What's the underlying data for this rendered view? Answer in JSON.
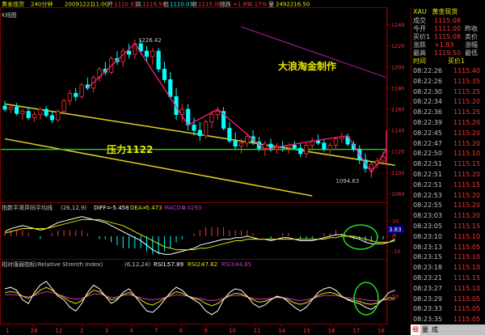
{
  "header": {
    "instrument": "黄金现货",
    "period": "240分钟",
    "date": "20091221",
    "time": "11:00",
    "open_label": "开",
    "open": "1110.93",
    "high_label": "高",
    "high": "1119.50",
    "low_label": "低",
    "low": "1110.03",
    "close_label": "收",
    "close": "1115.08",
    "change_label": "涨跌",
    "change": "+1.89",
    "pct": "0.17%",
    "amount_label": "量",
    "amount": "2492216.50"
  },
  "main_panel": {
    "label": "K线图",
    "price_labels": [
      {
        "value": 1240,
        "text": "1240"
      },
      {
        "value": 1220,
        "text": "1220"
      },
      {
        "value": 1200,
        "text": "1200"
      },
      {
        "value": 1180,
        "text": "1180"
      },
      {
        "value": 1160,
        "text": "1160"
      },
      {
        "value": 1140,
        "text": "1140"
      },
      {
        "value": 1120,
        "text": "1120"
      },
      {
        "value": 1100,
        "text": "1100"
      },
      {
        "value": 1080,
        "text": "1080"
      }
    ],
    "annotations": {
      "high_mark": "1226.42",
      "low_mark": "1094.63",
      "resistance": "压力1122",
      "credit": "大浪淘金制作"
    }
  },
  "macd_panel": {
    "title": "指数平滑异同平均线",
    "params": "(26,12,9)",
    "diff_label": "DIFF=",
    "diff": "-5.458",
    "dea_label": "DEA=",
    "dea": "-5.473",
    "macd_label": "MACD=",
    "macd": "0.0293",
    "axis_labels": [
      "10",
      "0",
      "-10"
    ],
    "value_box": "3.83"
  },
  "rsi_panel": {
    "title": "相对强弱指标(Relative Strenth Index)",
    "params": "(6,12,24)",
    "rsi1_label": "RSI1:",
    "rsi1": "57.89",
    "rsi2_label": "RSI2:",
    "rsi2": "47.82",
    "rsi3_label": "RSI3:",
    "rsi3": "44.85",
    "axis_labels": [
      "50"
    ]
  },
  "x_axis": {
    "labels": [
      "1",
      "28",
      "12",
      "2",
      "3",
      "4",
      "7",
      "8",
      "9",
      "10",
      "11",
      "14",
      "15",
      "16",
      "17",
      "18"
    ]
  },
  "side_panel": {
    "symbol": "XAU",
    "name": "黄金现货",
    "quote_rows": [
      {
        "label": "成交",
        "value": "1115.08",
        "label2": "",
        "value2": ""
      },
      {
        "label": "今开",
        "value": "1111.00",
        "label2": "昨收",
        "value2": ""
      },
      {
        "label": "买价1",
        "value": "1115.08",
        "label2": "卖价",
        "value2": ""
      },
      {
        "label": "涨跌",
        "value": "+1.83",
        "label2": "涨幅",
        "value2": ""
      },
      {
        "label": "最高",
        "value": "1119.50",
        "label2": "最低",
        "value2": ""
      }
    ],
    "trade_header_time": "时间",
    "trade_header_price": "买价1",
    "trades": [
      {
        "time": "08:22:26",
        "price": "1115.40"
      },
      {
        "time": "08:22:26",
        "price": "1115.35"
      },
      {
        "time": "08:22:30",
        "price": "1115.25"
      },
      {
        "time": "08:22:34",
        "price": "1115.20"
      },
      {
        "time": "08:22:36",
        "price": "1115.25"
      },
      {
        "time": "08:22:39",
        "price": "1115.20"
      },
      {
        "time": "08:22:45",
        "price": "1115.20"
      },
      {
        "time": "08:22:47",
        "price": "1115.20"
      },
      {
        "time": "08:22:50",
        "price": "1115.10"
      },
      {
        "time": "08:22:51",
        "price": "1115.15"
      },
      {
        "time": "08:22:51",
        "price": "1115.20"
      },
      {
        "time": "08:22:51",
        "price": "1115.15"
      },
      {
        "time": "08:22:53",
        "price": "1115.20"
      },
      {
        "time": "08:22:55",
        "price": "1115.20"
      },
      {
        "time": "08:23:03",
        "price": "1115.20"
      },
      {
        "time": "08:23:05",
        "price": "1115.15"
      },
      {
        "time": "08:23:10",
        "price": "1115.10"
      },
      {
        "time": "08:23:13",
        "price": "1115.05"
      },
      {
        "time": "08:23:15",
        "price": "1115.10"
      },
      {
        "time": "08:23:18",
        "price": "1115.10"
      },
      {
        "time": "08:23:21",
        "price": "1115.15"
      },
      {
        "time": "08:23:27",
        "price": "1115.10"
      },
      {
        "time": "08:23:29",
        "price": "1115.05"
      },
      {
        "time": "08:23:33",
        "price": "1115.05"
      },
      {
        "time": "08:23:35",
        "price": "1115.05"
      }
    ],
    "tabs": [
      "细",
      "量",
      "成"
    ]
  },
  "colors": {
    "up": "#ff3333",
    "down": "#00ffff",
    "channel": "#e6d21e",
    "support": "#22c422",
    "wave": "#ff1e78",
    "upper_line": "#b01ea0",
    "diff_line": "#ffffff",
    "dea_line": "#e6e600",
    "rsi1": "#ffffff",
    "rsi2": "#e6e600",
    "rsi3": "#cc33cc",
    "circle": "#22dd22",
    "header_text": "#e6e600"
  },
  "chart_data": [
    {
      "type": "candlestick",
      "title": "K线图",
      "ylim": [
        1075,
        1245
      ],
      "candles": [
        {
          "o": 1163,
          "h": 1168,
          "l": 1158,
          "c": 1160
        },
        {
          "o": 1160,
          "h": 1165,
          "l": 1156,
          "c": 1162
        },
        {
          "o": 1162,
          "h": 1166,
          "l": 1154,
          "c": 1156
        },
        {
          "o": 1156,
          "h": 1160,
          "l": 1150,
          "c": 1158
        },
        {
          "o": 1158,
          "h": 1162,
          "l": 1150,
          "c": 1152
        },
        {
          "o": 1152,
          "h": 1158,
          "l": 1148,
          "c": 1155
        },
        {
          "o": 1155,
          "h": 1162,
          "l": 1150,
          "c": 1160
        },
        {
          "o": 1160,
          "h": 1163,
          "l": 1152,
          "c": 1154
        },
        {
          "o": 1154,
          "h": 1158,
          "l": 1147,
          "c": 1150
        },
        {
          "o": 1150,
          "h": 1160,
          "l": 1148,
          "c": 1158
        },
        {
          "o": 1158,
          "h": 1170,
          "l": 1155,
          "c": 1168
        },
        {
          "o": 1168,
          "h": 1178,
          "l": 1164,
          "c": 1175
        },
        {
          "o": 1175,
          "h": 1180,
          "l": 1168,
          "c": 1172
        },
        {
          "o": 1172,
          "h": 1185,
          "l": 1170,
          "c": 1183
        },
        {
          "o": 1183,
          "h": 1190,
          "l": 1178,
          "c": 1180
        },
        {
          "o": 1180,
          "h": 1192,
          "l": 1176,
          "c": 1190
        },
        {
          "o": 1190,
          "h": 1200,
          "l": 1186,
          "c": 1198
        },
        {
          "o": 1198,
          "h": 1205,
          "l": 1192,
          "c": 1195
        },
        {
          "o": 1195,
          "h": 1210,
          "l": 1193,
          "c": 1208
        },
        {
          "o": 1208,
          "h": 1215,
          "l": 1202,
          "c": 1205
        },
        {
          "o": 1205,
          "h": 1218,
          "l": 1200,
          "c": 1215
        },
        {
          "o": 1215,
          "h": 1222,
          "l": 1208,
          "c": 1212
        },
        {
          "o": 1212,
          "h": 1226,
          "l": 1208,
          "c": 1222
        },
        {
          "o": 1222,
          "h": 1226,
          "l": 1212,
          "c": 1215
        },
        {
          "o": 1215,
          "h": 1220,
          "l": 1205,
          "c": 1210
        },
        {
          "o": 1210,
          "h": 1218,
          "l": 1202,
          "c": 1215
        },
        {
          "o": 1215,
          "h": 1218,
          "l": 1195,
          "c": 1198
        },
        {
          "o": 1198,
          "h": 1205,
          "l": 1185,
          "c": 1188
        },
        {
          "o": 1188,
          "h": 1195,
          "l": 1170,
          "c": 1172
        },
        {
          "o": 1172,
          "h": 1180,
          "l": 1150,
          "c": 1155
        },
        {
          "o": 1155,
          "h": 1165,
          "l": 1148,
          "c": 1160
        },
        {
          "o": 1160,
          "h": 1165,
          "l": 1140,
          "c": 1145
        },
        {
          "o": 1145,
          "h": 1152,
          "l": 1135,
          "c": 1140
        },
        {
          "o": 1140,
          "h": 1148,
          "l": 1130,
          "c": 1135
        },
        {
          "o": 1135,
          "h": 1150,
          "l": 1132,
          "c": 1148
        },
        {
          "o": 1148,
          "h": 1158,
          "l": 1142,
          "c": 1155
        },
        {
          "o": 1155,
          "h": 1162,
          "l": 1150,
          "c": 1158
        },
        {
          "o": 1158,
          "h": 1162,
          "l": 1140,
          "c": 1142
        },
        {
          "o": 1142,
          "h": 1148,
          "l": 1128,
          "c": 1130
        },
        {
          "o": 1130,
          "h": 1138,
          "l": 1122,
          "c": 1125
        },
        {
          "o": 1125,
          "h": 1132,
          "l": 1118,
          "c": 1128
        },
        {
          "o": 1128,
          "h": 1136,
          "l": 1124,
          "c": 1134
        },
        {
          "o": 1134,
          "h": 1140,
          "l": 1126,
          "c": 1129
        },
        {
          "o": 1129,
          "h": 1134,
          "l": 1120,
          "c": 1123
        },
        {
          "o": 1123,
          "h": 1130,
          "l": 1116,
          "c": 1127
        },
        {
          "o": 1127,
          "h": 1132,
          "l": 1120,
          "c": 1122
        },
        {
          "o": 1122,
          "h": 1128,
          "l": 1118,
          "c": 1125
        },
        {
          "o": 1125,
          "h": 1130,
          "l": 1120,
          "c": 1124
        },
        {
          "o": 1124,
          "h": 1128,
          "l": 1118,
          "c": 1126
        },
        {
          "o": 1126,
          "h": 1130,
          "l": 1122,
          "c": 1123
        },
        {
          "o": 1123,
          "h": 1128,
          "l": 1115,
          "c": 1118
        },
        {
          "o": 1118,
          "h": 1128,
          "l": 1114,
          "c": 1126
        },
        {
          "o": 1126,
          "h": 1133,
          "l": 1122,
          "c": 1130
        },
        {
          "o": 1130,
          "h": 1136,
          "l": 1126,
          "c": 1128
        },
        {
          "o": 1128,
          "h": 1132,
          "l": 1120,
          "c": 1122
        },
        {
          "o": 1122,
          "h": 1128,
          "l": 1118,
          "c": 1126
        },
        {
          "o": 1126,
          "h": 1134,
          "l": 1122,
          "c": 1132
        },
        {
          "o": 1132,
          "h": 1138,
          "l": 1128,
          "c": 1134
        },
        {
          "o": 1134,
          "h": 1137,
          "l": 1125,
          "c": 1127
        },
        {
          "o": 1127,
          "h": 1130,
          "l": 1120,
          "c": 1122
        },
        {
          "o": 1122,
          "h": 1126,
          "l": 1108,
          "c": 1112
        },
        {
          "o": 1112,
          "h": 1118,
          "l": 1100,
          "c": 1104
        },
        {
          "o": 1104,
          "h": 1110,
          "l": 1095,
          "c": 1108
        },
        {
          "o": 1108,
          "h": 1114,
          "l": 1104,
          "c": 1111
        },
        {
          "o": 1111,
          "h": 1120,
          "l": 1110,
          "c": 1115
        }
      ],
      "channel_upper": [
        [
          0,
          1165
        ],
        [
          66,
          1107
        ]
      ],
      "channel_lower": [
        [
          0,
          1132
        ],
        [
          52,
          1078
        ]
      ],
      "support": 1122,
      "purple_line": [
        [
          40,
          1238
        ],
        [
          70,
          1190
        ]
      ],
      "wave_points": [
        [
          14,
          1180
        ],
        [
          22,
          1222
        ],
        [
          31,
          1145
        ],
        [
          36,
          1160
        ],
        [
          44,
          1122
        ],
        [
          50,
          1128
        ],
        [
          58,
          1135
        ],
        [
          62,
          1100
        ],
        [
          66,
          1122
        ],
        [
          68,
          1108
        ],
        [
          70,
          1140
        ]
      ]
    },
    {
      "type": "macd",
      "title": "指数平滑异同平均线",
      "ylim": [
        -14,
        16
      ],
      "diff": [
        3,
        5,
        6,
        7,
        6,
        5,
        4,
        5,
        7,
        9,
        10,
        11,
        12,
        13,
        12,
        11,
        10,
        9,
        7,
        5,
        3,
        1,
        -1,
        -3,
        -6,
        -9,
        -11,
        -12,
        -12,
        -11,
        -10,
        -9,
        -8,
        -6,
        -5,
        -4,
        -3,
        -2,
        -2,
        -1,
        -1,
        0,
        -1,
        -2,
        -2,
        -3,
        -2,
        -1,
        -1,
        -2,
        -3,
        -3,
        -3,
        -2,
        -1,
        0,
        1,
        1,
        0,
        -1,
        -2,
        -4,
        -5,
        -5,
        -5,
        -4,
        -2
      ],
      "dea": [
        2,
        3,
        4,
        5,
        5,
        5,
        5,
        5,
        6,
        7,
        8,
        9,
        10,
        11,
        11,
        11,
        11,
        10,
        9,
        8,
        7,
        5,
        3,
        1,
        -1,
        -3,
        -5,
        -7,
        -8,
        -9,
        -9,
        -9,
        -9,
        -8,
        -8,
        -7,
        -6,
        -5,
        -4,
        -3,
        -3,
        -2,
        -2,
        -2,
        -2,
        -2,
        -2,
        -2,
        -2,
        -2,
        -2,
        -2,
        -2,
        -2,
        -2,
        -1,
        -1,
        0,
        0,
        0,
        -1,
        -2,
        -3,
        -4,
        -4,
        -4,
        -3
      ]
    },
    {
      "type": "rsi",
      "title": "相对强弱指标",
      "ylim": [
        15,
        85
      ],
      "rsi1": [
        60,
        62,
        58,
        45,
        40,
        55,
        65,
        70,
        60,
        50,
        45,
        35,
        30,
        40,
        55,
        65,
        60,
        50,
        40,
        45,
        55,
        60,
        50,
        40,
        30,
        28,
        35,
        45,
        55,
        62,
        58,
        50,
        45,
        40,
        30,
        25,
        30,
        45,
        55,
        60,
        58,
        50,
        40,
        35,
        38,
        45,
        50,
        48,
        42,
        35,
        30,
        35,
        45,
        55,
        60,
        62,
        58,
        50,
        45,
        42,
        40,
        35,
        32,
        38,
        46,
        55,
        58
      ],
      "rsi2": [
        55,
        56,
        55,
        50,
        47,
        52,
        58,
        62,
        58,
        52,
        48,
        43,
        40,
        44,
        52,
        58,
        56,
        50,
        45,
        47,
        52,
        55,
        50,
        45,
        40,
        38,
        42,
        47,
        52,
        56,
        54,
        50,
        47,
        45,
        40,
        37,
        40,
        46,
        51,
        54,
        53,
        49,
        45,
        42,
        43,
        46,
        49,
        48,
        45,
        41,
        39,
        41,
        46,
        51,
        54,
        55,
        53,
        49,
        46,
        44,
        43,
        40,
        39,
        41,
        45,
        48,
        47
      ],
      "rsi3": [
        52,
        52,
        52,
        50,
        49,
        51,
        54,
        56,
        55,
        52,
        50,
        47,
        46,
        47,
        50,
        53,
        53,
        51,
        48,
        49,
        51,
        52,
        50,
        48,
        46,
        45,
        46,
        48,
        50,
        52,
        51,
        50,
        48,
        47,
        45,
        44,
        45,
        47,
        50,
        51,
        51,
        49,
        47,
        46,
        46,
        47,
        48,
        48,
        47,
        45,
        44,
        45,
        47,
        49,
        51,
        51,
        51,
        49,
        48,
        47,
        46,
        45,
        44,
        44,
        45,
        45,
        45
      ]
    }
  ]
}
